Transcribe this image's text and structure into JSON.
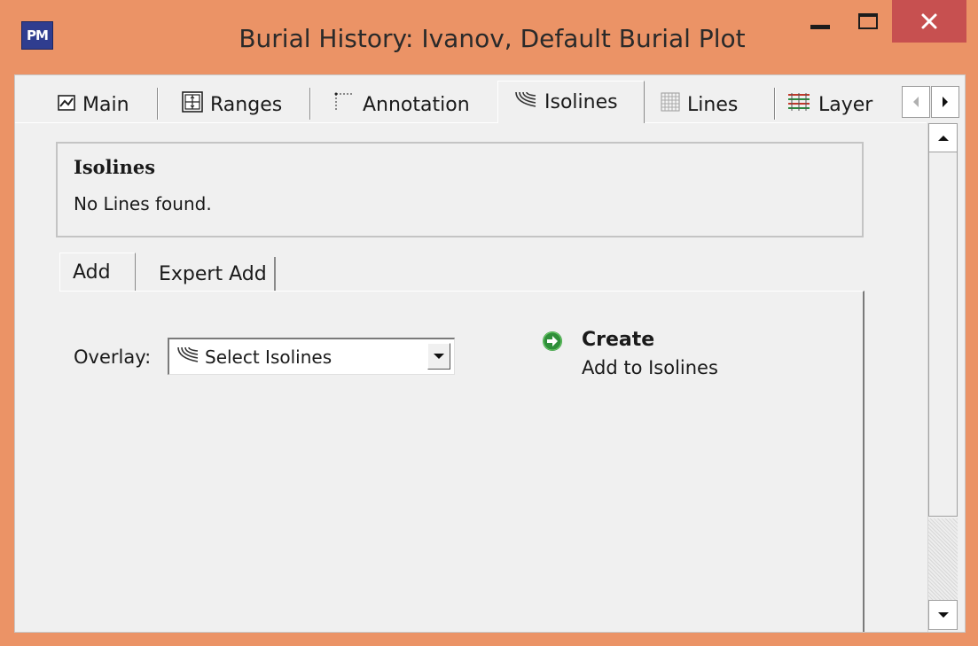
{
  "window": {
    "title": "Burial History: Ivanov,  Default Burial Plot",
    "app_icon_text": "PM",
    "titlebar_color": "#EB9366",
    "close_color": "#C75050"
  },
  "tabs": [
    {
      "label": "Main",
      "icon": "chart-line-icon",
      "active": false
    },
    {
      "label": "Ranges",
      "icon": "ranges-grid-icon",
      "active": false
    },
    {
      "label": "Annotation",
      "icon": "annotation-icon",
      "active": false
    },
    {
      "label": "Isolines",
      "icon": "isolines-icon",
      "active": true
    },
    {
      "label": "Lines",
      "icon": "lines-grid-icon",
      "active": false
    },
    {
      "label": "Layer",
      "icon": "layer-icon",
      "active": false
    }
  ],
  "isolines_group": {
    "title": "Isolines",
    "status": "No Lines found."
  },
  "subtabs": [
    {
      "label": "Add",
      "active": true
    },
    {
      "label": "Expert Add",
      "active": false
    }
  ],
  "overlay": {
    "label": "Overlay:",
    "selected": "Select Isolines"
  },
  "create": {
    "title": "Create",
    "subtitle": "Add to Isolines"
  }
}
